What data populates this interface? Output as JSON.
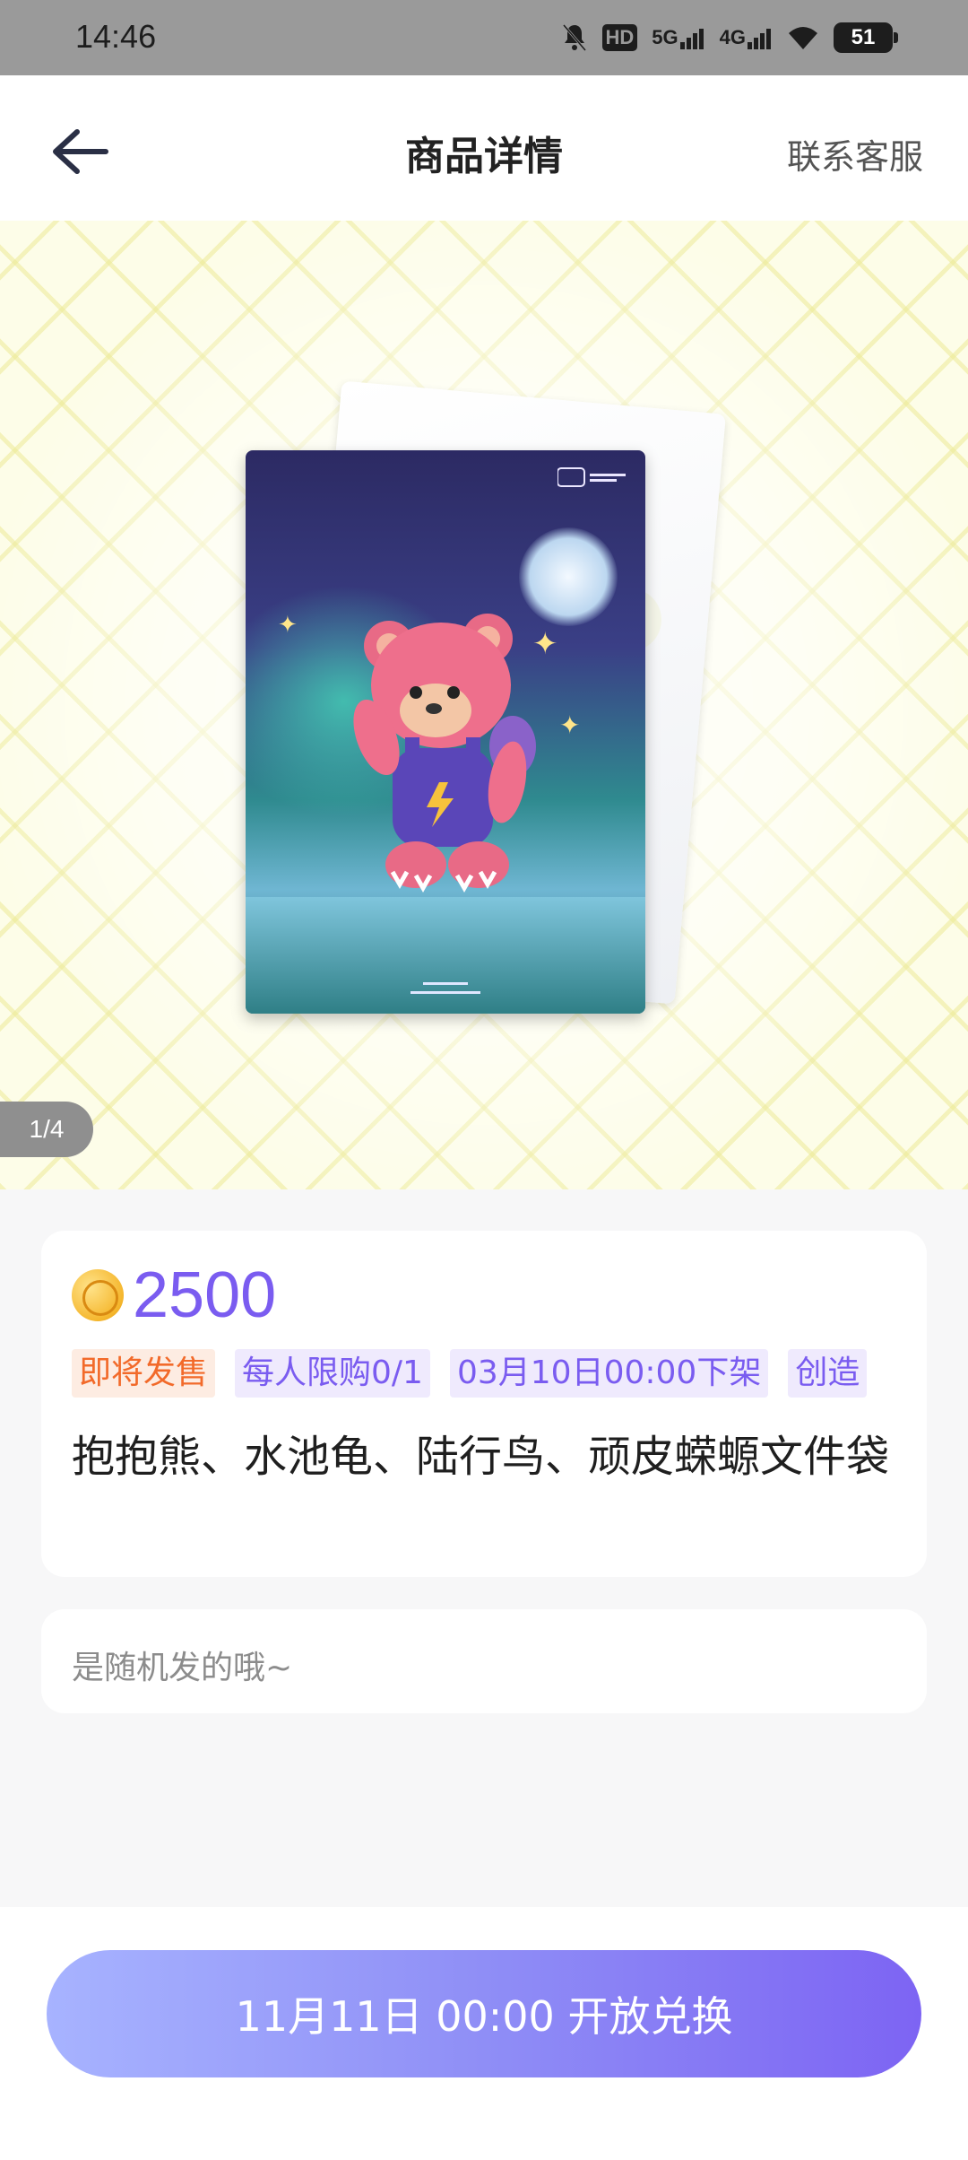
{
  "status_bar": {
    "time": "14:46",
    "hd_label": "HD",
    "net1": "5G",
    "net2": "4G",
    "battery": "51"
  },
  "nav": {
    "title": "商品详情",
    "service_label": "联系客服"
  },
  "gallery": {
    "pager": "1/4"
  },
  "product": {
    "price": "2500",
    "tags": [
      {
        "text": "即将发售",
        "color": "#f26a2a"
      },
      {
        "text": "每人限购0/1",
        "color": "#7a5cf0"
      },
      {
        "text": "03月10日00:00下架",
        "color": "#7a5cf0"
      },
      {
        "text": "创造",
        "color": "#7a5cf0"
      }
    ],
    "name": "抱抱熊、水池龟、陆行鸟、顽皮蝾螈文件袋",
    "note": "是随机发的哦~"
  },
  "action": {
    "button_label": "11月11日 00:00 开放兑换"
  },
  "colors": {
    "accent": "#7a5cf0",
    "tag_orange": "#f26a2a"
  }
}
